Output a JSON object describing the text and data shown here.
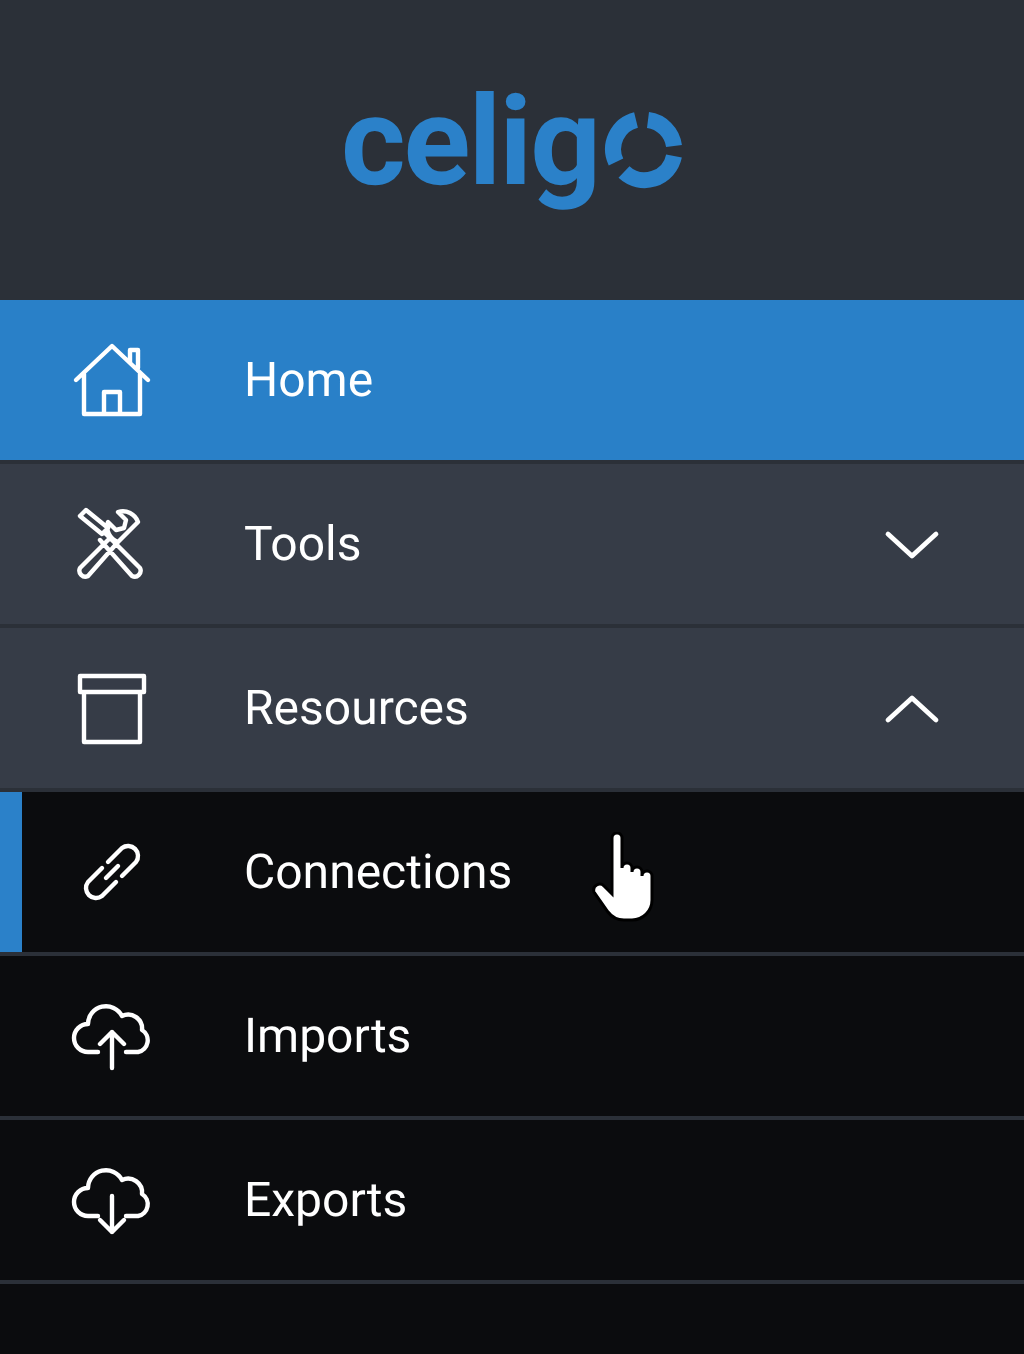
{
  "logo": {
    "text": "celig"
  },
  "nav": [
    {
      "kind": "top",
      "label": "Home",
      "selected": true
    },
    {
      "kind": "group",
      "label": "Tools",
      "selected": false,
      "expanded": false
    },
    {
      "kind": "group",
      "label": "Resources",
      "selected": false,
      "expanded": true
    },
    {
      "kind": "sub",
      "label": "Connections",
      "selected": true
    },
    {
      "kind": "sub",
      "label": "Imports",
      "selected": false
    },
    {
      "kind": "sub",
      "label": "Exports",
      "selected": false
    }
  ]
}
